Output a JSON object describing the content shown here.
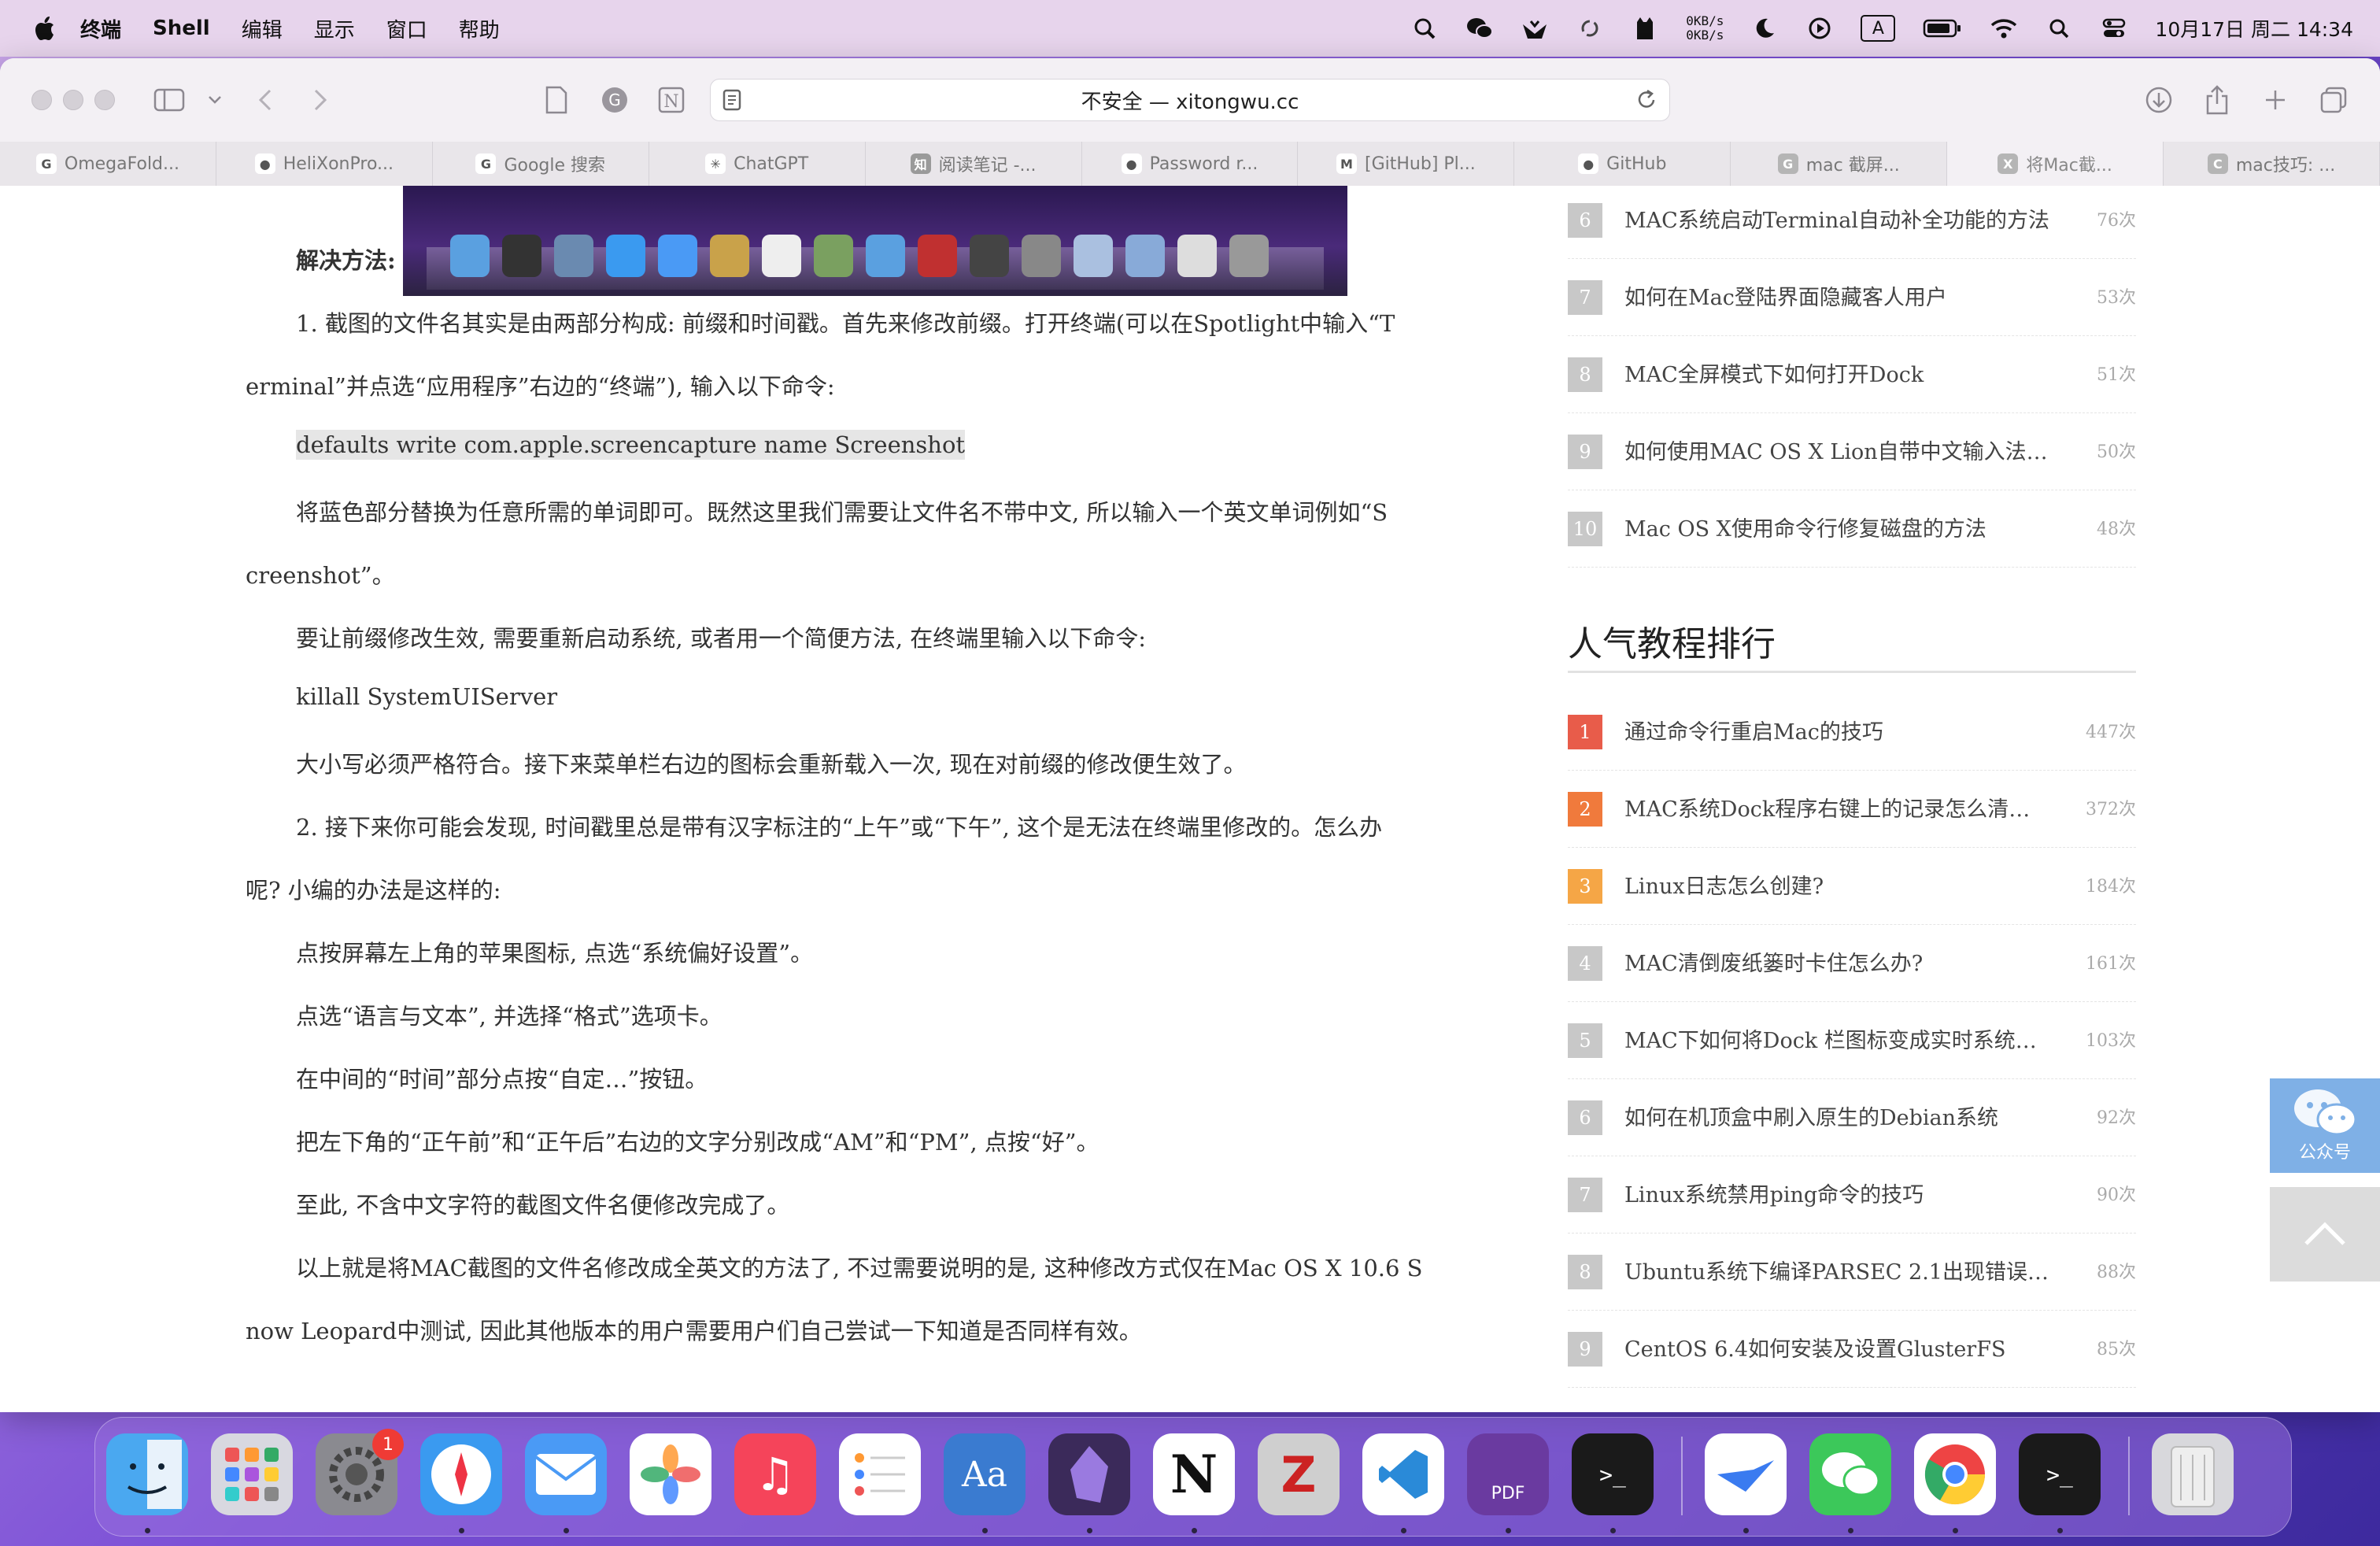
{
  "menubar": {
    "app_name": "终端",
    "items": [
      "Shell",
      "编辑",
      "显示",
      "窗口",
      "帮助"
    ],
    "net_up": "0KB/s",
    "net_down": "0KB/s",
    "input_indicator": "A",
    "clock": "10月17日 周二  14:34"
  },
  "browser": {
    "address_text": "不安全 — xitongwu.cc",
    "tabs": [
      {
        "label": "OmegaFold...",
        "icon": "google-icon",
        "color": "#ffffff"
      },
      {
        "label": "HeliXonPro...",
        "icon": "github-icon",
        "color": "#ffffff"
      },
      {
        "label": "Google 搜索",
        "icon": "google-icon",
        "color": "#ffffff"
      },
      {
        "label": "ChatGPT",
        "icon": "chatgpt-icon",
        "color": "#ffffff"
      },
      {
        "label": "阅读笔记 -...",
        "icon": "zhihu-icon",
        "color": "#9a9a9a"
      },
      {
        "label": "Password r...",
        "icon": "github-icon",
        "color": "#ffffff"
      },
      {
        "label": "[GitHub] Pl...",
        "icon": "gmail-icon",
        "color": "#ffffff"
      },
      {
        "label": "GitHub",
        "icon": "github-icon",
        "color": "#ffffff"
      },
      {
        "label": "mac 截屏...",
        "icon": "g-icon",
        "color": "#b5b5b5"
      },
      {
        "label": "将Mac截...",
        "icon": "x-icon",
        "color": "#b5b5b5"
      },
      {
        "label": "mac技巧: ...",
        "icon": "c-icon",
        "color": "#b5b5b5"
      }
    ]
  },
  "article": {
    "heading": "解决方法:",
    "p1_line1": "1. 截图的文件名其实是由两部分构成: 前缀和时间戳。首先来修改前缀。打开终端(可以在Spotlight中输入“T",
    "p1_line2": "erminal”并点选“应用程序”右边的“终端”), 输入以下命令:",
    "cmd1": "defaults write com.apple.screencapture name Screenshot",
    "p2_line1": "将蓝色部分替换为任意所需的单词即可。既然这里我们需要让文件名不带中文, 所以输入一个英文单词例如“S",
    "p2_line2": "creenshot”。",
    "p3": "要让前缀修改生效, 需要重新启动系统, 或者用一个简便方法, 在终端里输入以下命令:",
    "cmd2": "killall SystemUIServer",
    "p4": "大小写必须严格符合。接下来菜单栏右边的图标会重新载入一次, 现在对前缀的修改便生效了。",
    "p5_line1": "2. 接下来你可能会发现, 时间戳里总是带有汉字标注的“上午”或“下午”, 这个是无法在终端里修改的。怎么办",
    "p5_line2": "呢? 小编的办法是这样的:",
    "p6": "点按屏幕左上角的苹果图标, 点选“系统偏好设置”。",
    "p7": "点选“语言与文本”, 并选择“格式”选项卡。",
    "p8": "在中间的“时间”部分点按“自定…”按钮。",
    "p9": "把左下角的“正午前”和“正午后”右边的文字分别改成“AM”和“PM”, 点按“好”。",
    "p10": "至此, 不含中文字符的截图文件名便修改完成了。",
    "p11_line1": "以上就是将MAC截图的文件名修改成全英文的方法了, 不过需要说明的是, 这种修改方式仅在Mac OS X 10.6 S",
    "p11_line2": "now Leopard中测试, 因此其他版本的用户需要用户们自己尝试一下知道是否同样有效。"
  },
  "sidebar": {
    "top_list": [
      {
        "num": "6",
        "title": "MAC系统启动Terminal自动补全功能的方法",
        "count": "76次"
      },
      {
        "num": "7",
        "title": "如何在Mac登陆界面隐藏客人用户",
        "count": "53次"
      },
      {
        "num": "8",
        "title": "MAC全屏模式下如何打开Dock",
        "count": "51次"
      },
      {
        "num": "9",
        "title": "如何使用MAC OS X Lion自带中文输入法…",
        "count": "50次"
      },
      {
        "num": "10",
        "title": "Mac OS X使用命令行修复磁盘的方法",
        "count": "48次"
      }
    ],
    "popular_title": "人气教程排行",
    "popular_list": [
      {
        "num": "1",
        "title": "通过命令行重启Mac的技巧",
        "count": "447次",
        "color": "#e85c4a"
      },
      {
        "num": "2",
        "title": "MAC系统Dock程序右键上的记录怎么清…",
        "count": "372次",
        "color": "#f07a3c"
      },
      {
        "num": "3",
        "title": "Linux日志怎么创建?",
        "count": "184次",
        "color": "#f5a646"
      },
      {
        "num": "4",
        "title": "MAC清倒废纸篓时卡住怎么办?",
        "count": "161次",
        "color": "#c8c8c8"
      },
      {
        "num": "5",
        "title": "MAC下如何将Dock 栏图标变成实时系统…",
        "count": "103次",
        "color": "#c8c8c8"
      },
      {
        "num": "6",
        "title": "如何在机顶盒中刷入原生的Debian系统",
        "count": "92次",
        "color": "#c8c8c8"
      },
      {
        "num": "7",
        "title": "Linux系统禁用ping命令的技巧",
        "count": "90次",
        "color": "#c8c8c8"
      },
      {
        "num": "8",
        "title": "Ubuntu系统下编译PARSEC 2.1出现错误…",
        "count": "88次",
        "color": "#c8c8c8"
      },
      {
        "num": "9",
        "title": "CentOS 6.4如何安装及设置GlusterFS",
        "count": "85次",
        "color": "#c8c8c8"
      }
    ],
    "wechat_label": "公众号"
  },
  "dock": {
    "settings_badge": "1",
    "apps": [
      {
        "name": "finder",
        "color": "#4aa8f0"
      },
      {
        "name": "launchpad",
        "color": "#d8d8e0"
      },
      {
        "name": "system-settings",
        "color": "#8a8a90"
      },
      {
        "name": "safari",
        "color": "#3a9af0"
      },
      {
        "name": "mail",
        "color": "#4a9af5"
      },
      {
        "name": "photos",
        "color": "#ffffff"
      },
      {
        "name": "music",
        "color": "#f5445a"
      },
      {
        "name": "reminders",
        "color": "#ffffff"
      },
      {
        "name": "dictionary",
        "color": "#3a7bd0"
      },
      {
        "name": "obsidian",
        "color": "#3b2a5a"
      },
      {
        "name": "notion",
        "color": "#ffffff"
      },
      {
        "name": "zotero",
        "color": "#cfcfcf"
      },
      {
        "name": "vscode",
        "color": "#ffffff"
      },
      {
        "name": "pdf-expert",
        "color": "#6a3aa0"
      },
      {
        "name": "terminal-pro",
        "color": "#1a1a1a"
      },
      {
        "name": "lark",
        "color": "#ffffff"
      },
      {
        "name": "wechat",
        "color": "#3cc85a"
      },
      {
        "name": "chrome",
        "color": "#ffffff"
      },
      {
        "name": "terminal",
        "color": "#1a1a1a"
      },
      {
        "name": "trash",
        "color": "#d8d8dc"
      }
    ],
    "pdf_label": "PDF",
    "notion_letter": "N",
    "dictionary_label": "Aa"
  }
}
